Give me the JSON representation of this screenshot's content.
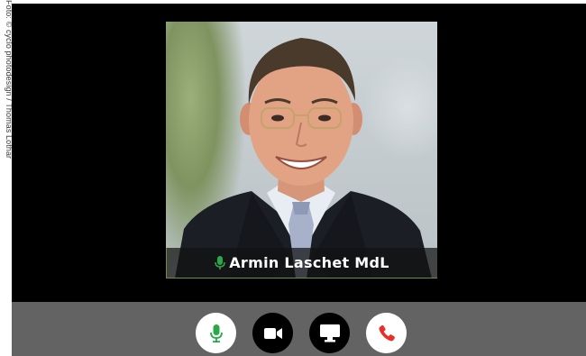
{
  "credit": {
    "text": "Foto: © cyclo photodesign / Thomas Lothar"
  },
  "participant": {
    "name": "Armin Laschet MdL",
    "mic_state": "on"
  },
  "controls": [
    {
      "name": "microphone",
      "icon": "mic-icon",
      "active": true
    },
    {
      "name": "camera",
      "icon": "video-camera-icon"
    },
    {
      "name": "screen-share",
      "icon": "monitor-icon"
    },
    {
      "name": "hang-up",
      "icon": "phone-hangup-icon"
    }
  ],
  "colors": {
    "window_bg": "#000000",
    "control_bar_bg": "#636363",
    "mic_green": "#2ba84a",
    "hangup_red": "#e8302a",
    "name_bar_bg": "#1a1a1a"
  }
}
